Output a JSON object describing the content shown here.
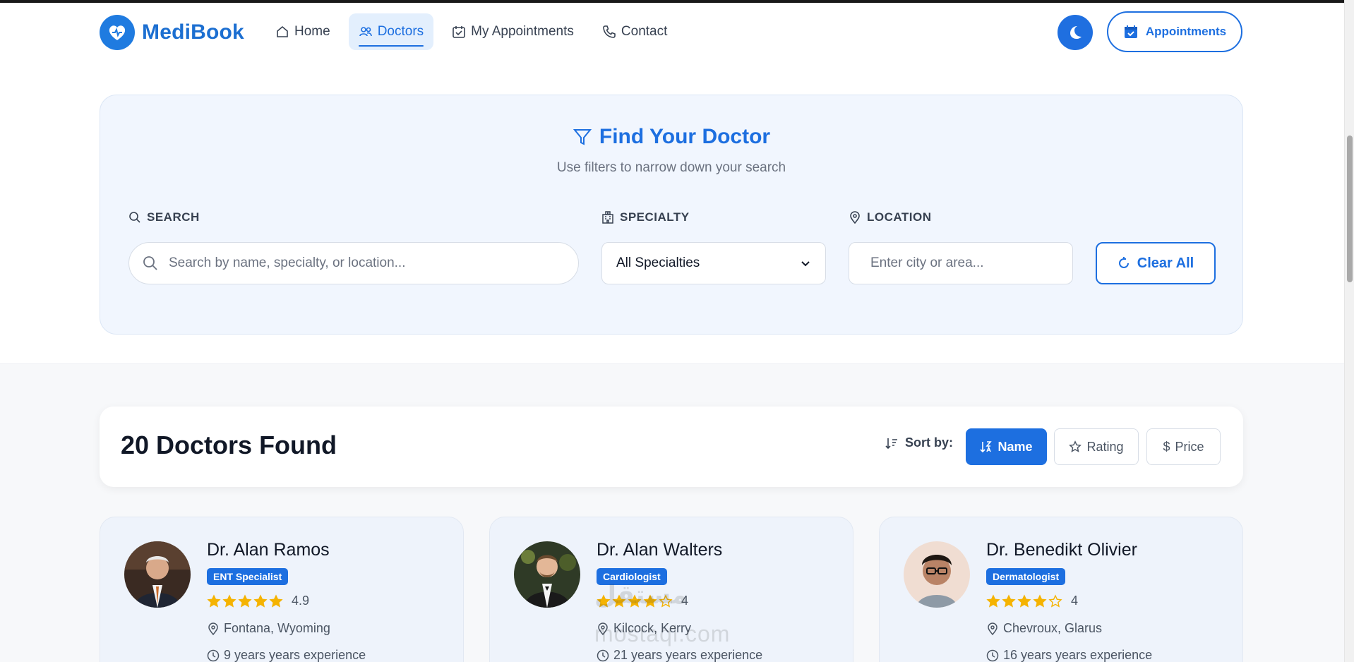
{
  "header": {
    "brand": "MediBook",
    "nav": [
      {
        "label": "Home",
        "icon": "home-icon"
      },
      {
        "label": "Doctors",
        "icon": "users-icon",
        "active": true
      },
      {
        "label": "My Appointments",
        "icon": "calendar-check-icon"
      },
      {
        "label": "Contact",
        "icon": "phone-icon"
      }
    ],
    "theme_toggle_icon": "moon-icon",
    "appointments_button": "Appointments"
  },
  "filters": {
    "title": "Find Your Doctor",
    "subtitle": "Use filters to narrow down your search",
    "search_label": "SEARCH",
    "search_placeholder": "Search by name, specialty, or location...",
    "specialty_label": "SPECIALTY",
    "specialty_value": "All Specialties",
    "location_label": "LOCATION",
    "location_placeholder": "Enter city or area...",
    "clear_button": "Clear All"
  },
  "results": {
    "count_text": "20 Doctors Found",
    "sort_label": "Sort by:",
    "sort_options": [
      {
        "label": "Name",
        "icon": "sort-alpha-icon",
        "active": true
      },
      {
        "label": "Rating",
        "icon": "star-outline-icon"
      },
      {
        "label": "Price",
        "icon": "dollar-icon"
      }
    ]
  },
  "doctors": [
    {
      "name": "Dr. Alan Ramos",
      "specialty": "ENT Specialist",
      "rating": "4.9",
      "rating_value": 4.9,
      "location": "Fontana, Wyoming",
      "experience": "9 years years experience"
    },
    {
      "name": "Dr. Alan Walters",
      "specialty": "Cardiologist",
      "rating": "4",
      "rating_value": 4,
      "location": "Kilcock, Kerry",
      "experience": "21 years years experience"
    },
    {
      "name": "Dr. Benedikt Olivier",
      "specialty": "Dermatologist",
      "rating": "4",
      "rating_value": 4,
      "location": "Chevroux, Glarus",
      "experience": "16 years years experience"
    }
  ],
  "watermark": {
    "line1": "مستقل",
    "line2": "mostaql.com"
  },
  "colors": {
    "accent": "#1d6fe0",
    "star": "#f5b301",
    "brand": "#1c6fd1"
  }
}
